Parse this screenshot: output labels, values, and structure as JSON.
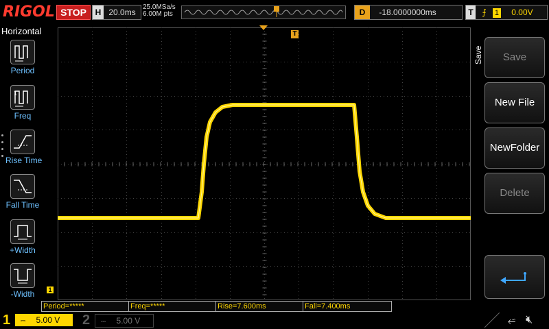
{
  "topbar": {
    "logo": "RIGOL",
    "run_state": "STOP",
    "horizontal_key": "H",
    "timebase": "20.0ms",
    "sample_rate": "25.0MSa/s",
    "memory_depth": "6.00M pts",
    "delay_key": "D",
    "delay": "-18.0000000ms",
    "trigger_key": "T",
    "trigger_channel": "1",
    "trigger_level": "0.00V"
  },
  "left_panel": {
    "title": "Horizontal",
    "items": [
      {
        "label": "Period",
        "icon": "period-icon"
      },
      {
        "label": "Freq",
        "icon": "frequency-icon"
      },
      {
        "label": "Rise Time",
        "icon": "rise-time-icon"
      },
      {
        "label": "Fall Time",
        "icon": "fall-time-icon"
      },
      {
        "label": "+Width",
        "icon": "positive-width-icon"
      },
      {
        "label": "-Width",
        "icon": "negative-width-icon"
      }
    ]
  },
  "right_panel": {
    "title": "Save",
    "buttons": [
      {
        "label": "Save",
        "enabled": false
      },
      {
        "label": "New File",
        "enabled": true
      },
      {
        "label": "NewFolder",
        "enabled": true
      },
      {
        "label": "Delete",
        "enabled": false
      },
      {
        "label": "",
        "icon": "return-arrow-icon",
        "enabled": true
      }
    ]
  },
  "measurements": {
    "period": "Period=*****",
    "freq": "Freq=*****",
    "rise": "Rise=7.600ms",
    "fall": "Fall=7.400ms"
  },
  "markers": {
    "channel_marker": "1",
    "trigger_marker": "T"
  },
  "bottombar": {
    "ch1_number": "1",
    "ch1_scale": "5.00 V",
    "ch2_number": "2",
    "ch2_scale": "5.00 V"
  },
  "colors": {
    "channel1": "#ffd700",
    "accent_orange": "#e8a21b",
    "stop_red": "#c81e1e"
  }
}
